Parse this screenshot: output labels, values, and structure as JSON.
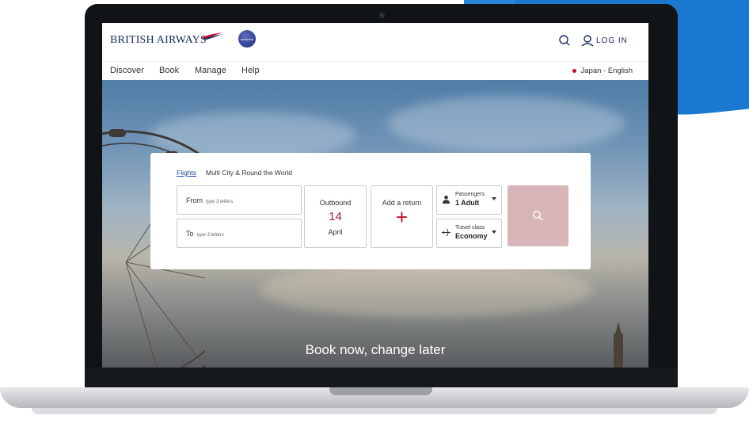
{
  "header": {
    "brand": "BRITISH AIRWAYS",
    "partner_badge": "oneworld",
    "login_label": "LOG IN"
  },
  "nav": {
    "items": [
      "Discover",
      "Book",
      "Manage",
      "Help"
    ],
    "locale": "Japan - English"
  },
  "booking": {
    "tabs": [
      "Flights",
      "Multi City & Round the World"
    ],
    "from_label": "From",
    "from_placeholder": "type 3 letters",
    "to_label": "To",
    "to_placeholder": "type 3 letters",
    "outbound_label": "Outbound",
    "outbound_day": "14",
    "outbound_month": "April",
    "return_label": "Add a return",
    "return_icon": "+",
    "passengers_label": "Passengers",
    "passengers_value": "1 Adult",
    "class_label": "Travel class",
    "class_value": "Economy",
    "search_icon": "search-icon"
  },
  "hero": {
    "tagline": "Book now, change later"
  },
  "colors": {
    "brand_navy": "#1a2a5e",
    "accent_red": "#c8102e",
    "search_button": "#d8b5b9"
  }
}
